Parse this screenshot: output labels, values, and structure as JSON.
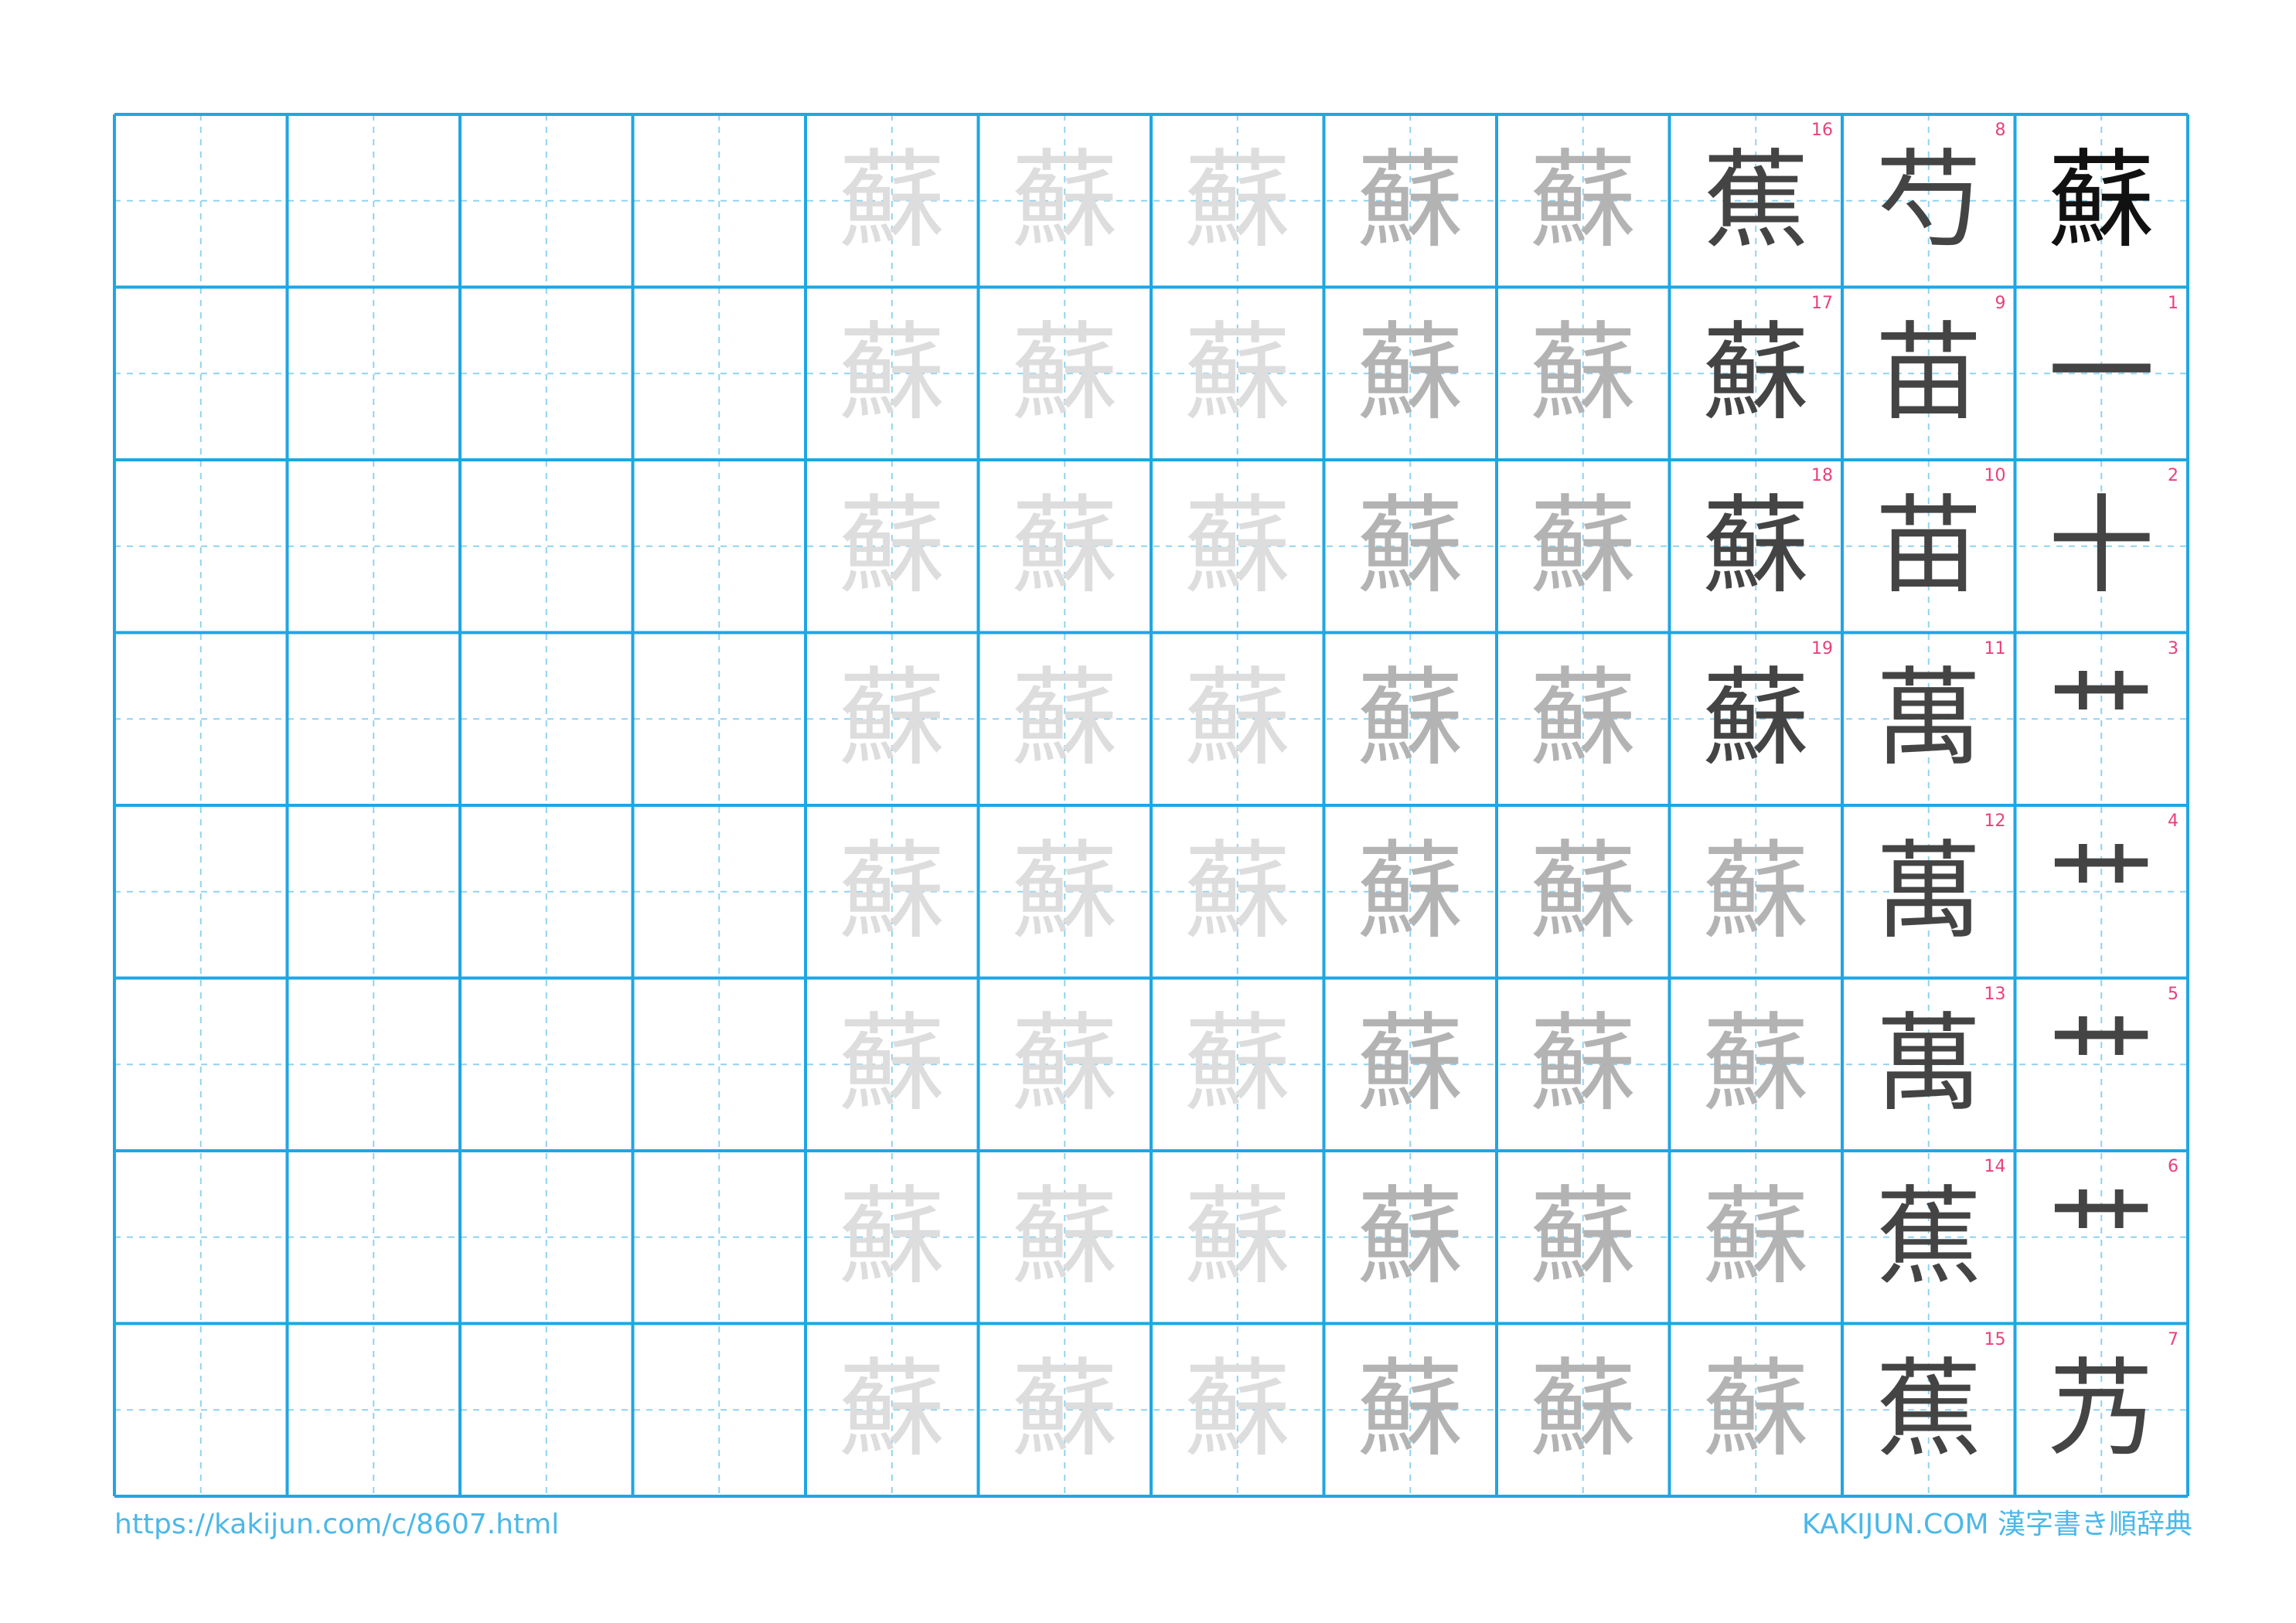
{
  "kanji": "蘇",
  "stroke_steps": [
    {
      "n": "1",
      "glyph": "一"
    },
    {
      "n": "2",
      "glyph": "十"
    },
    {
      "n": "3",
      "glyph": "艹"
    },
    {
      "n": "4",
      "glyph": "艹"
    },
    {
      "n": "5",
      "glyph": "艹"
    },
    {
      "n": "6",
      "glyph": "艹"
    },
    {
      "n": "7",
      "glyph": "艿"
    },
    {
      "n": "8",
      "glyph": "芍"
    },
    {
      "n": "9",
      "glyph": "苗"
    },
    {
      "n": "10",
      "glyph": "苗"
    },
    {
      "n": "11",
      "glyph": "萬"
    },
    {
      "n": "12",
      "glyph": "萬"
    },
    {
      "n": "13",
      "glyph": "萬"
    },
    {
      "n": "14",
      "glyph": "蕉"
    },
    {
      "n": "15",
      "glyph": "蕉"
    },
    {
      "n": "16",
      "glyph": "蕉"
    },
    {
      "n": "17",
      "glyph": "蘇"
    },
    {
      "n": "18",
      "glyph": "蘇"
    },
    {
      "n": "19",
      "glyph": "蘇"
    }
  ],
  "footer": {
    "url": "https://kakijun.com/c/8607.html",
    "site": "KAKIJUN.COM 漢字書き順辞典"
  },
  "colors": {
    "grid_line": "#1fa6e3",
    "guide_line": "#8fd3f0",
    "stroke_number": "#e8417a",
    "model_char": "#111111",
    "step_char": "#444444",
    "trace_dark": "#b3b3b3",
    "trace_light": "#dddddd",
    "footer_text": "#4bb8e8"
  }
}
